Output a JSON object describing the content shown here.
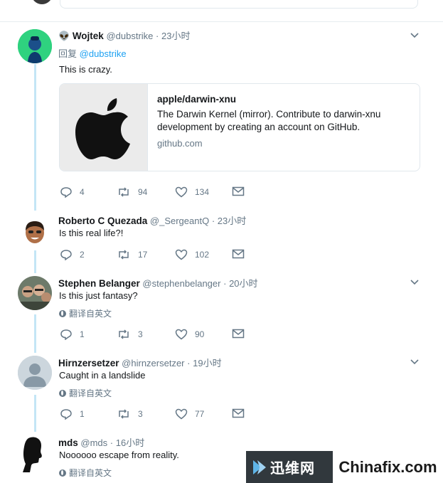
{
  "tweets": [
    {
      "name": "Wojtek",
      "emoji": "👽",
      "handle": "@dubstrike",
      "time": "23小时",
      "reply_prefix": "回复",
      "reply_mention": "@dubstrike",
      "text": "This is crazy.",
      "card": {
        "title": "apple/darwin-xnu",
        "description": "The Darwin Kernel (mirror). Contribute to darwin-xnu development by creating an account on GitHub.",
        "domain": "github.com"
      },
      "replies": "4",
      "retweets": "94",
      "likes": "134"
    },
    {
      "name": "Roberto C Quezada",
      "handle": "@_SergeantQ",
      "time": "23小时",
      "text": "Is this real life?!",
      "replies": "2",
      "retweets": "17",
      "likes": "102"
    },
    {
      "name": "Stephen Belanger",
      "handle": "@stephenbelanger",
      "time": "20小时",
      "text": "Is this just fantasy?",
      "translate": "翻译自英文",
      "replies": "1",
      "retweets": "3",
      "likes": "90"
    },
    {
      "name": "Hirnzersetzer",
      "handle": "@hirnzersetzer",
      "time": "19小时",
      "text": "Caught in a landslide",
      "translate": "翻译自英文",
      "replies": "1",
      "retweets": "3",
      "likes": "77"
    },
    {
      "name": "mds",
      "handle": "@mds",
      "time": "16小时",
      "text": "Noooooo escape from reality.",
      "translate": "翻译自英文"
    }
  ],
  "separator": "·",
  "watermark": {
    "cn": "迅维网",
    "en": "Chinafix.com"
  },
  "colors": {
    "accent": "#1da1f2",
    "muted": "#657786",
    "thread_line": "#c4e6f6"
  }
}
